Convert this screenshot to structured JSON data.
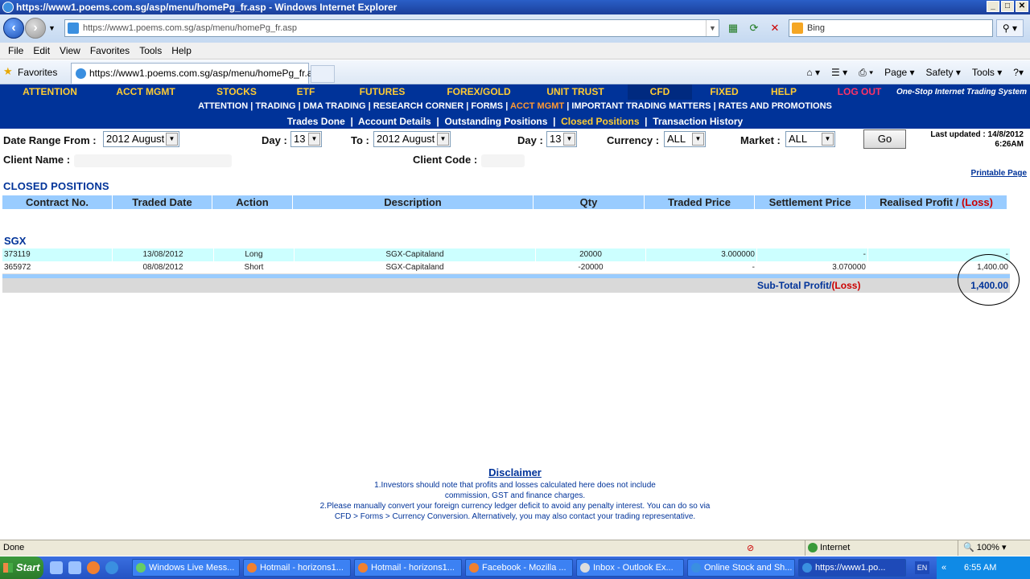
{
  "window": {
    "title": "https://www1.poems.com.sg/asp/menu/homePg_fr.asp - Windows Internet Explorer",
    "address": "https://www1.poems.com.sg/asp/menu/homePg_fr.asp",
    "search_placeholder": "Bing",
    "tab_title": "https://www1.poems.com.sg/asp/menu/homePg_fr.asp",
    "favorites_label": "Favorites",
    "menu": [
      "File",
      "Edit",
      "View",
      "Favorites",
      "Tools",
      "Help"
    ],
    "command_items": [
      "Page ▾",
      "Safety ▾",
      "Tools ▾"
    ]
  },
  "site_nav": {
    "items": [
      "ATTENTION",
      "ACCT MGMT",
      "STOCKS",
      "ETF",
      "FUTURES",
      "FOREX/GOLD",
      "UNIT TRUST",
      "CFD",
      "FIXED INCOME",
      "HELP",
      "LOG OUT"
    ],
    "tagline": "One-Stop Internet Trading System"
  },
  "sub_nav": {
    "items": [
      "ATTENTION",
      "TRADING",
      "DMA TRADING",
      "RESEARCH CORNER",
      "FORMS",
      "ACCT MGMT",
      "IMPORTANT TRADING MATTERS",
      "RATES AND PROMOTIONS"
    ],
    "active": "ACCT MGMT"
  },
  "account_nav": {
    "items": [
      "Trades Done",
      "Account Details",
      "Outstanding Positions",
      "Closed Positions",
      "Transaction History"
    ],
    "active": "Closed Positions"
  },
  "filters": {
    "date_from_label": "Date Range From :",
    "date_from_value": "2012 August",
    "day_label": "Day :",
    "day_from_value": "13",
    "to_label": "To :",
    "date_to_value": "2012 August",
    "day_to_value": "13",
    "currency_label": "Currency :",
    "currency_value": "ALL",
    "market_label": "Market :",
    "market_value": "ALL",
    "go_label": "Go",
    "last_updated_line1": "Last updated : 14/8/2012",
    "last_updated_line2": "6:26AM",
    "client_name_label": "Client Name :",
    "client_code_label": "Client Code :"
  },
  "printable_label": "Printable Page",
  "section_title": "CLOSED POSITIONS",
  "table": {
    "headers": [
      "Contract No.",
      "Traded Date",
      "Action",
      "Description",
      "Qty",
      "Traded Price",
      "Settlement Price"
    ],
    "header_profit": "Realised Profit / ",
    "header_loss": "(Loss)",
    "market_group": "SGX",
    "rows": [
      {
        "contract": "373119",
        "date": "13/08/2012",
        "action": "Long",
        "description": "SGX-Capitaland",
        "qty": "20000",
        "traded_price": "3.000000",
        "settlement_price": "-",
        "profit": "-"
      },
      {
        "contract": "365972",
        "date": "08/08/2012",
        "action": "Short",
        "description": "SGX-Capitaland",
        "qty": "-20000",
        "traded_price": "-",
        "settlement_price": "3.070000",
        "profit": "1,400.00"
      }
    ],
    "subtotal_label": "Sub-Total Profit/",
    "subtotal_loss": "(Loss)",
    "subtotal_value": "1,400.00"
  },
  "disclaimer": {
    "title": "Disclaimer",
    "lines": [
      "1.Investors should note that profits and losses calculated here does not include",
      "commission, GST and finance charges.",
      "2.Please manually convert your foreign currency ledger deficit to avoid any penalty interest. You can do so via",
      "CFD > Forms > Currency Conversion. Alternatively, you may also contact your trading representative."
    ]
  },
  "status": {
    "text": "Done",
    "zone": "Internet",
    "zoom": "100%"
  },
  "taskbar": {
    "start": "Start",
    "tasks": [
      "Windows Live Mess...",
      "Hotmail - horizons1...",
      "Hotmail - horizons1...",
      "Facebook - Mozilla ...",
      "Inbox - Outlook Ex...",
      "Online Stock and Sh...",
      "https://www1.po..."
    ],
    "lang": "EN",
    "time": "6:55 AM"
  }
}
